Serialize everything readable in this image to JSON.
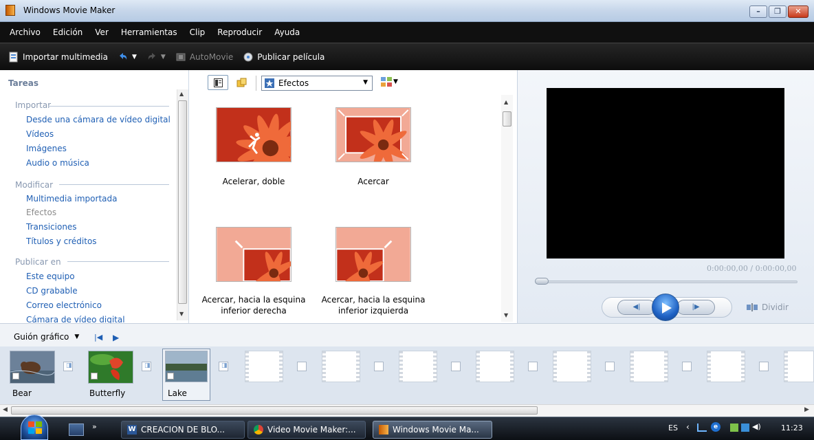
{
  "window": {
    "title": "Windows Movie Maker",
    "min": "–",
    "max": "❐",
    "close": "✕"
  },
  "menu": [
    "Archivo",
    "Edición",
    "Ver",
    "Herramientas",
    "Clip",
    "Reproducir",
    "Ayuda"
  ],
  "toolbar": {
    "import_label": "Importar multimedia",
    "automovie_label": "AutoMovie",
    "publish_label": "Publicar película"
  },
  "tasks": {
    "header": "Tareas",
    "import_section": "Importar",
    "import_items": [
      "Desde una cámara de vídeo digital",
      "Vídeos",
      "Imágenes",
      "Audio o música"
    ],
    "modify_section": "Modificar",
    "modify_items": [
      "Multimedia importada",
      "Efectos",
      "Transiciones",
      "Títulos y créditos"
    ],
    "publish_section": "Publicar en",
    "publish_items": [
      "Este equipo",
      "CD grabable",
      "Correo electrónico",
      "Cámara de vídeo digital"
    ]
  },
  "effects": {
    "dropdown_value": "Efectos",
    "tiles": [
      {
        "label1": "Acelerar, doble",
        "label2": ""
      },
      {
        "label1": "Acercar",
        "label2": ""
      },
      {
        "label1": "Acercar, hacia la esquina",
        "label2": "inferior derecha"
      },
      {
        "label1": "Acercar, hacia la esquina",
        "label2": "inferior izquierda"
      }
    ]
  },
  "preview": {
    "time": "0:00:00,00 / 0:00:00,00",
    "split_label": "Dividir"
  },
  "storyboard": {
    "mode_label": "Guión gráfico",
    "clips": [
      "Bear",
      "Butterfly",
      "Lake"
    ]
  },
  "taskbar": {
    "buttons": [
      "CREACION DE BLO...",
      "Video Movie Maker:...",
      "Windows Movie Ma..."
    ],
    "lang": "ES",
    "clock": "11:23"
  },
  "colors": {
    "accent": "#1f5fb4",
    "menu_bg": "#101010",
    "flower": "#e0452a"
  }
}
